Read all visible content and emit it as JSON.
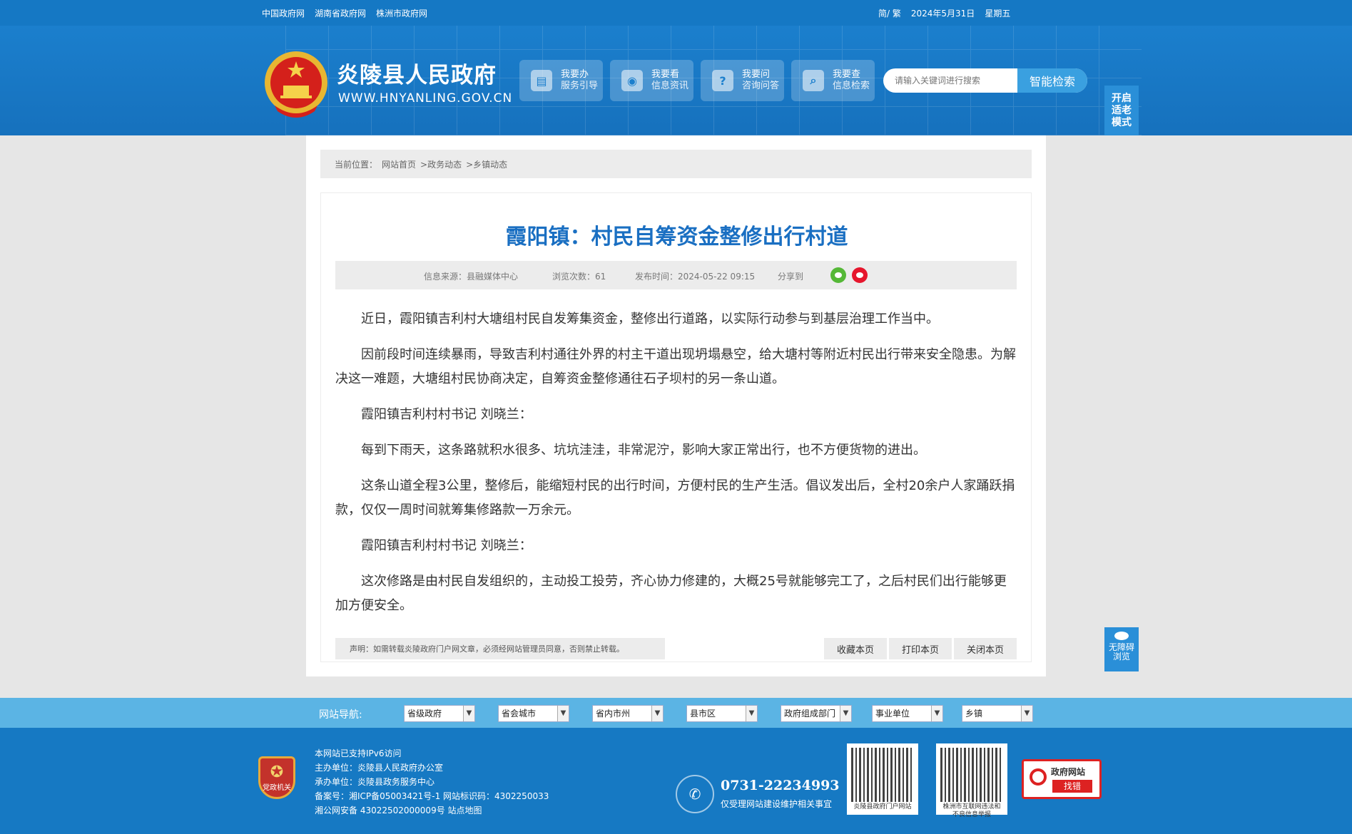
{
  "topbar": {
    "links": [
      "中国政府网",
      "湖南省政府网",
      "株洲市政府网"
    ],
    "lang": "简/ 繁",
    "date": "2024年5月31日",
    "weekday": "星期五"
  },
  "header": {
    "title": "炎陵县人民政府",
    "url": "WWW.HNYANLING.GOV.CN",
    "quick": [
      {
        "icon": "doc-icon",
        "glyph": "▤",
        "title": "我要办",
        "sub": "服务引导"
      },
      {
        "icon": "eye-icon",
        "glyph": "◉",
        "title": "我要看",
        "sub": "信息资讯"
      },
      {
        "icon": "question-icon",
        "glyph": "?",
        "title": "我要问",
        "sub": "咨询问答"
      },
      {
        "icon": "search-icon",
        "glyph": "⌕",
        "title": "我要查",
        "sub": "信息检索"
      }
    ],
    "search_placeholder": "请输入关键词进行搜索",
    "search_button": "智能检索",
    "elder_mode": [
      "开启",
      "适老",
      "模式"
    ]
  },
  "breadcrumb": {
    "label": "当前位置：",
    "items": [
      "网站首页",
      ">政务动态",
      ">乡镇动态"
    ]
  },
  "article": {
    "title": "霞阳镇：村民自筹资金整修出行村道",
    "source": "信息来源：县融媒体中心",
    "views": "浏览次数：61",
    "published": "发布时间：2024-05-22 09:15",
    "share": "分享到",
    "paragraphs": [
      "近日，霞阳镇吉利村大塘组村民自发筹集资金，整修出行道路，以实际行动参与到基层治理工作当中。",
      "因前段时间连续暴雨，导致吉利村通往外界的村主干道出现坍塌悬空，给大塘村等附近村民出行带来安全隐患。为解决这一难题，大塘组村民协商决定，自筹资金整修通往石子坝村的另一条山道。",
      "霞阳镇吉利村村书记 刘晓兰：",
      "每到下雨天，这条路就积水很多、坑坑洼洼，非常泥泞，影响大家正常出行，也不方便货物的进出。",
      "这条山道全程3公里，整修后，能缩短村民的出行时间，方便村民的生产生活。倡议发出后，全村20余户人家踊跃捐款，仅仅一周时间就筹集修路款一万余元。",
      "霞阳镇吉利村村书记 刘晓兰：",
      "这次修路是由村民自发组织的，主动投工投劳，齐心协力修建的，大概25号就能够完工了，之后村民们出行能够更加方便安全。"
    ],
    "notice": "声明：如需转载炎陵政府门户网文章，必须经网站管理员同意，否则禁止转载。",
    "actions": [
      "收藏本页",
      "打印本页",
      "关闭本页"
    ]
  },
  "a11y": [
    "无障碍",
    "浏览"
  ],
  "nav": {
    "label": "网站导航:",
    "selects": [
      "省级政府",
      "省会城市",
      "省内市州",
      "县市区",
      "政府组成部门",
      "事业单位",
      "乡镇"
    ]
  },
  "footer": {
    "badge": [
      "党政机关"
    ],
    "info": [
      "本网站已支持IPv6访问",
      "主办单位：炎陵县人民政府办公室",
      "承办单位：炎陵县政务服务中心",
      "备案号：湘ICP备05003421号-1 网站标识码：4302250033",
      "湘公网安备 43022502000009号 站点地图"
    ],
    "phone": "0731-22234993",
    "phone_note": "仅受理网站建设维护相关事宜",
    "qr1_caption": "炎陵县政府门户网站",
    "qr2_caption": "株洲市互联网违法和不良信息举报",
    "gov_find": [
      "政府网站",
      "找错"
    ]
  }
}
